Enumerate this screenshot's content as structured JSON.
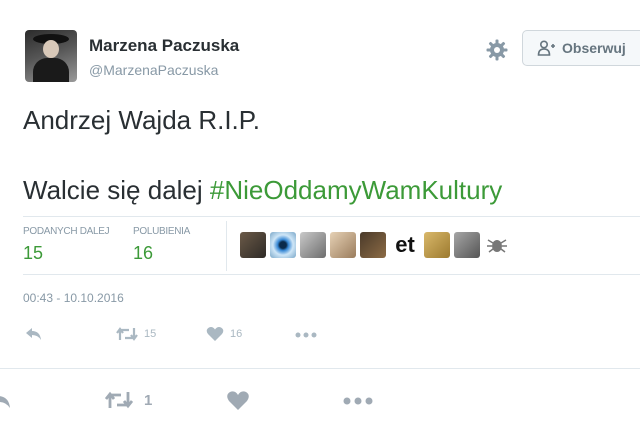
{
  "user": {
    "display_name": "Marzena Paczuska",
    "handle": "@MarzenaPaczuska"
  },
  "header": {
    "follow_label": "Obserwuj"
  },
  "tweet": {
    "line1": "Andrzej Wajda R.I.P.",
    "line2_text": "Walcie się dalej ",
    "hashtag": "#NieOddamyWamKultury"
  },
  "stats": {
    "retweets_label": "PODANYCH DALEJ",
    "retweets_count": "15",
    "likes_label": "POLUBIENIA",
    "likes_count": "16"
  },
  "likers": {
    "et_text": "et"
  },
  "timestamp": "00:43 - 10.10.2016",
  "actions": {
    "retweet_count": "15",
    "like_count": "16"
  },
  "bottom_actions": {
    "retweet_count": "1"
  },
  "colors": {
    "hashtag": "#3c9a38",
    "muted": "#8899a6",
    "text": "#292f33"
  }
}
